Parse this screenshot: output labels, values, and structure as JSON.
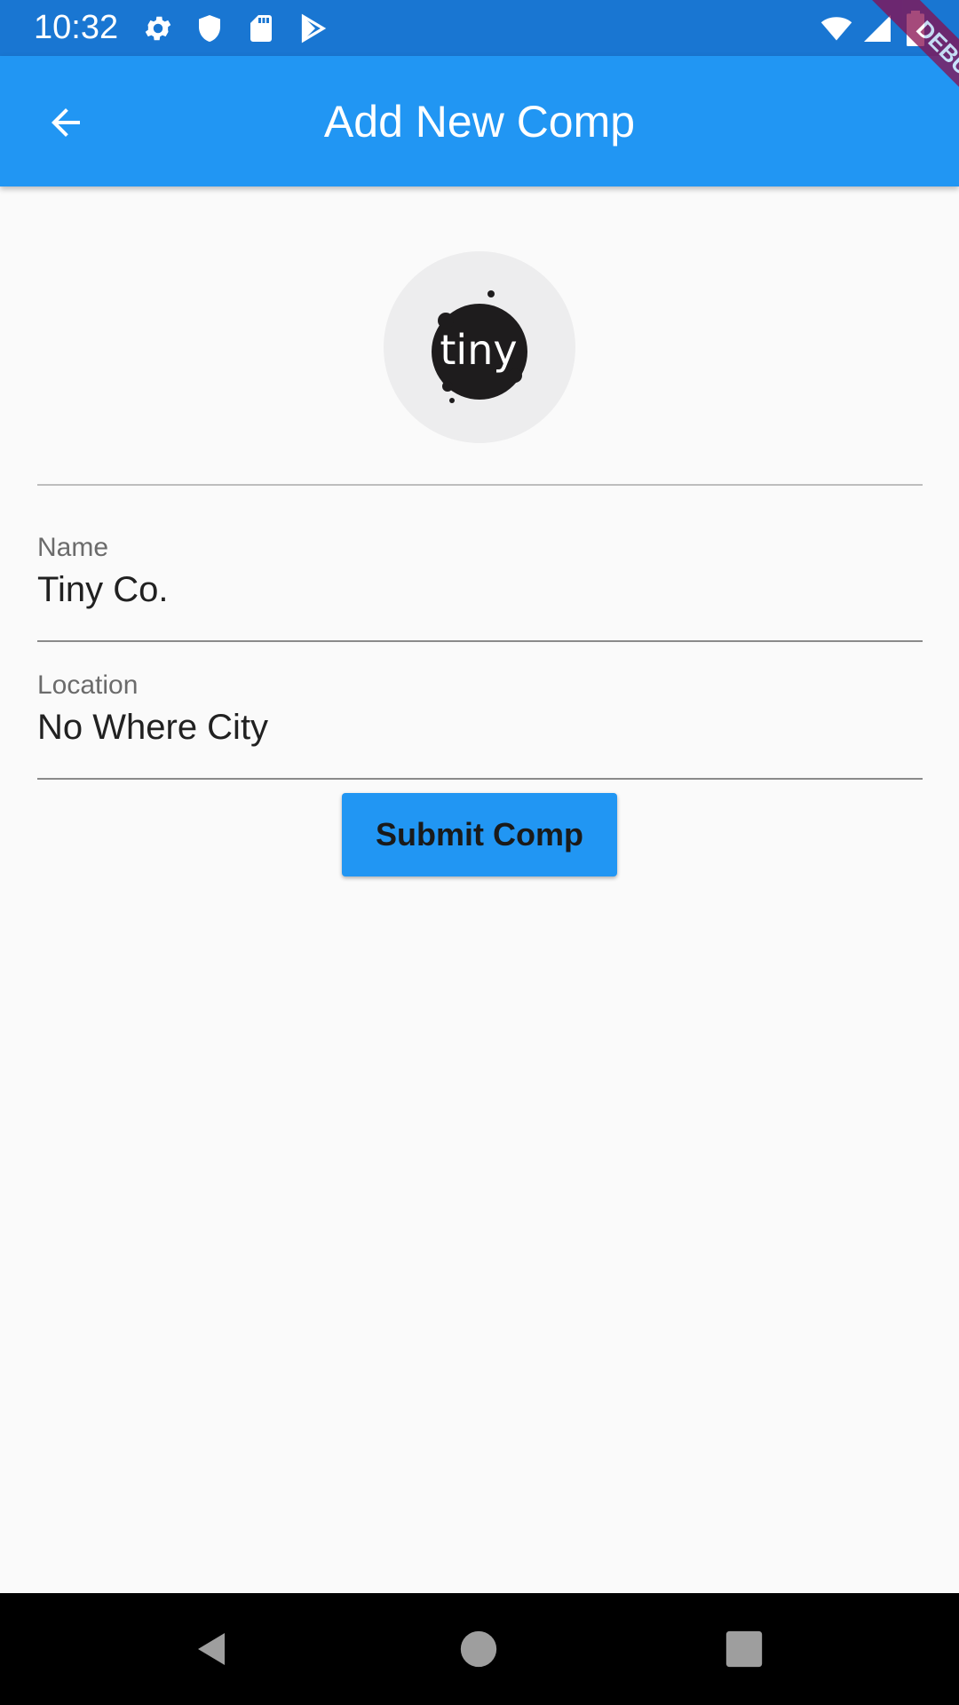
{
  "status_bar": {
    "time": "10:32",
    "left_icons": [
      "gear-icon",
      "shield-icon",
      "sd-card-icon",
      "play-store-icon"
    ],
    "right_icons": [
      "wifi-icon",
      "cell-signal-icon",
      "battery-icon"
    ],
    "background": "#1976d2"
  },
  "app_bar": {
    "title": "Add New Comp",
    "back_icon": "arrow-back-icon",
    "background": "#2196f3"
  },
  "debug_banner": {
    "label": "DEBUG",
    "color": "#880e4f"
  },
  "avatar": {
    "logo_text": "tiny"
  },
  "form": {
    "name": {
      "label": "Name",
      "value": "Tiny Co."
    },
    "location": {
      "label": "Location",
      "value": "No Where City"
    }
  },
  "submit_button": {
    "label": "Submit Comp",
    "color": "#2196f3"
  },
  "nav_bar": {
    "buttons": [
      "back-triangle-icon",
      "home-circle-icon",
      "recents-square-icon"
    ]
  }
}
